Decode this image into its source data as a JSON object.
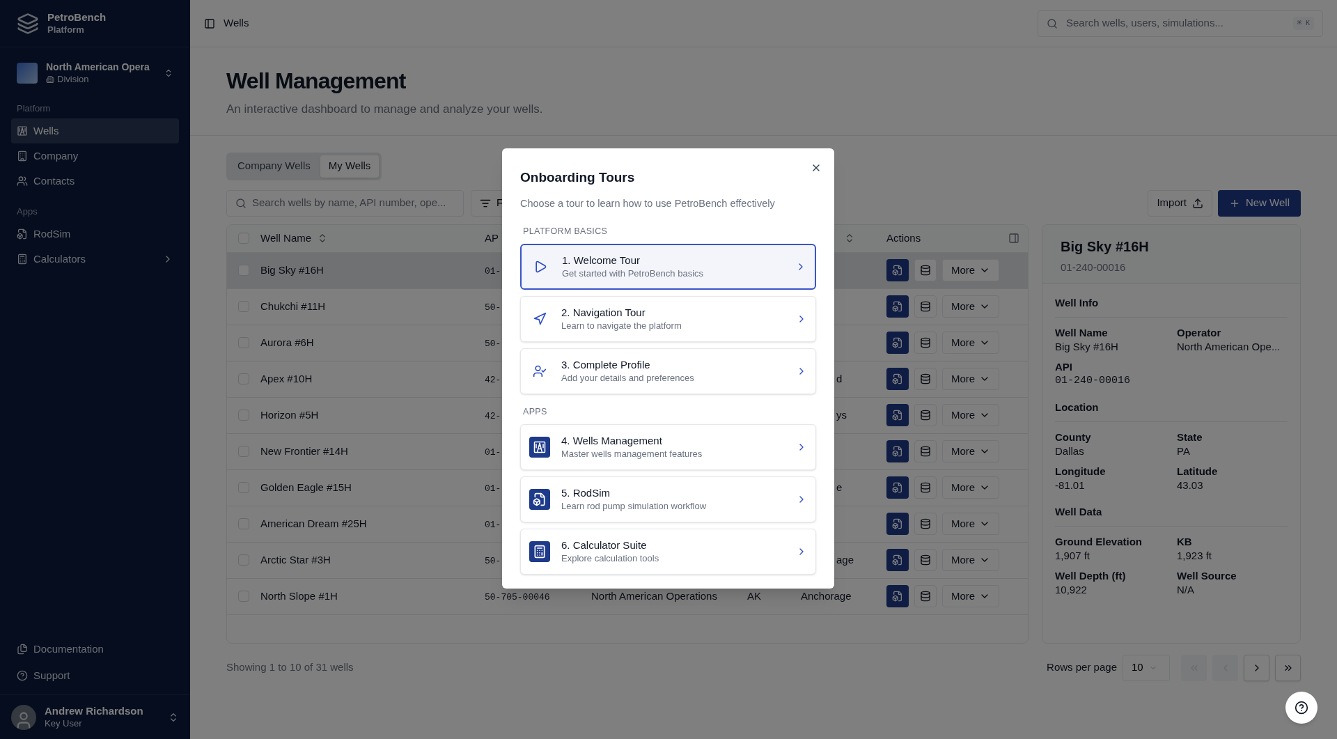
{
  "sidebar": {
    "brand": {
      "name": "PetroBench",
      "subtitle": "Platform"
    },
    "org": {
      "name": "North American Opera",
      "type": "Division"
    },
    "sections": [
      {
        "label": "Platform",
        "items": [
          {
            "label": "Wells",
            "selected": true,
            "has_submenu": false
          },
          {
            "label": "Company",
            "selected": false,
            "has_submenu": false
          },
          {
            "label": "Contacts",
            "selected": false,
            "has_submenu": false
          }
        ]
      },
      {
        "label": "Apps",
        "items": [
          {
            "label": "RodSim",
            "selected": false,
            "has_submenu": false
          },
          {
            "label": "Calculators",
            "selected": false,
            "has_submenu": true
          }
        ]
      }
    ],
    "footer_links": [
      "Documentation",
      "Support"
    ],
    "user": {
      "name": "Andrew Richardson",
      "role": "Key User"
    }
  },
  "topbar": {
    "breadcrumb": "Wells",
    "search": {
      "placeholder": "Search wells, users, simulations...",
      "shortcut": "⌘ K"
    }
  },
  "page": {
    "title": "Well Management",
    "subtitle": "An interactive dashboard to manage and analyze your wells.",
    "tabs": [
      {
        "label": "Company Wells",
        "selected": false
      },
      {
        "label": "My Wells",
        "selected": true
      }
    ],
    "search": {
      "placeholder": "Search wells by name, API number, ope..."
    },
    "filter_button": "F",
    "import_button": "Import",
    "new_button": "New Well"
  },
  "table": {
    "all_checked": false,
    "columns": [
      {
        "label": "Well Name",
        "sortable": true
      },
      {
        "label": "AP",
        "sortable": false
      },
      {
        "sortable": true
      },
      {
        "label": "Actions",
        "sortable": false
      }
    ],
    "rows": [
      {
        "name": "Big Sky #16H",
        "api": "01-",
        "selected": true,
        "more": "More"
      },
      {
        "name": "Chukchi #11H",
        "api": "50-",
        "selected": false,
        "more": "More"
      },
      {
        "name": "Aurora #6H",
        "api": "50-",
        "selected": false,
        "more": "More"
      },
      {
        "name": "Apex #10H",
        "api": "42-",
        "county": "d",
        "selected": false,
        "more": "More"
      },
      {
        "name": "Horizon #5H",
        "api": "42-",
        "county": "ys",
        "selected": false,
        "more": "More"
      },
      {
        "name": "New Frontier #14H",
        "api": "01-",
        "selected": false,
        "more": "More"
      },
      {
        "name": "Golden Eagle #15H",
        "api": "01-",
        "county": "e",
        "selected": false,
        "more": "More"
      },
      {
        "name": "American Dream #25H",
        "api": "01-",
        "selected": false,
        "more": "More"
      },
      {
        "name": "Arctic Star #3H",
        "api": "50-",
        "county": "age",
        "selected": false,
        "more": "More"
      },
      {
        "name": "North Slope #1H",
        "api": "50-705-00046",
        "operator": "North American Operations",
        "state": "AK",
        "county": "Anchorage",
        "selected": false,
        "more": "More"
      }
    ]
  },
  "detail": {
    "title": "Big Sky #16H",
    "api": "01-240-00016",
    "sections": [
      {
        "title": "Well Info",
        "fields": [
          {
            "label": "Well Name",
            "value": "Big Sky #16H"
          },
          {
            "label": "Operator",
            "value": "North American Ope..."
          },
          {
            "label": "API",
            "value": "01-240-00016",
            "mono": true
          }
        ]
      },
      {
        "title": "Location",
        "fields": [
          {
            "label": "County",
            "value": "Dallas"
          },
          {
            "label": "State",
            "value": "PA"
          },
          {
            "label": "Longitude",
            "value": "-81.01"
          },
          {
            "label": "Latitude",
            "value": "43.03"
          }
        ]
      },
      {
        "title": "Well Data",
        "fields": [
          {
            "label": "Ground Elevation",
            "value": "1,907 ft"
          },
          {
            "label": "KB",
            "value": "1,923 ft"
          },
          {
            "label": "Well Depth (ft)",
            "value": "10,922"
          },
          {
            "label": "Well Source",
            "value": "N/A"
          }
        ]
      }
    ]
  },
  "footer": {
    "summary": "Showing 1 to 10 of 31 wells",
    "rows_label": "Rows per page",
    "rows_value": "10",
    "pager": [
      {
        "disabled": true
      },
      {
        "disabled": true
      },
      {
        "disabled": false
      },
      {
        "disabled": false
      }
    ]
  },
  "modal": {
    "title": "Onboarding Tours",
    "description": "Choose a tour to learn how to use PetroBench effectively",
    "groups": [
      {
        "label": "PLATFORM BASICS",
        "tours": [
          {
            "title": "1. Welcome Tour",
            "description": "Get started with PetroBench basics",
            "selected": true,
            "kind": "outline"
          },
          {
            "title": "2. Navigation Tour",
            "description": "Learn to navigate the platform",
            "selected": false,
            "kind": "outline"
          },
          {
            "title": "3. Complete Profile",
            "description": "Add your details and preferences",
            "selected": false,
            "kind": "outline"
          }
        ]
      },
      {
        "label": "APPS",
        "tours": [
          {
            "title": "4. Wells Management",
            "description": "Master wells management features",
            "selected": false,
            "kind": "tile"
          },
          {
            "title": "5. RodSim",
            "description": "Learn rod pump simulation workflow",
            "selected": false,
            "kind": "tile"
          },
          {
            "title": "6. Calculator Suite",
            "description": "Explore calculation tools",
            "selected": false,
            "kind": "tile"
          }
        ]
      }
    ]
  }
}
